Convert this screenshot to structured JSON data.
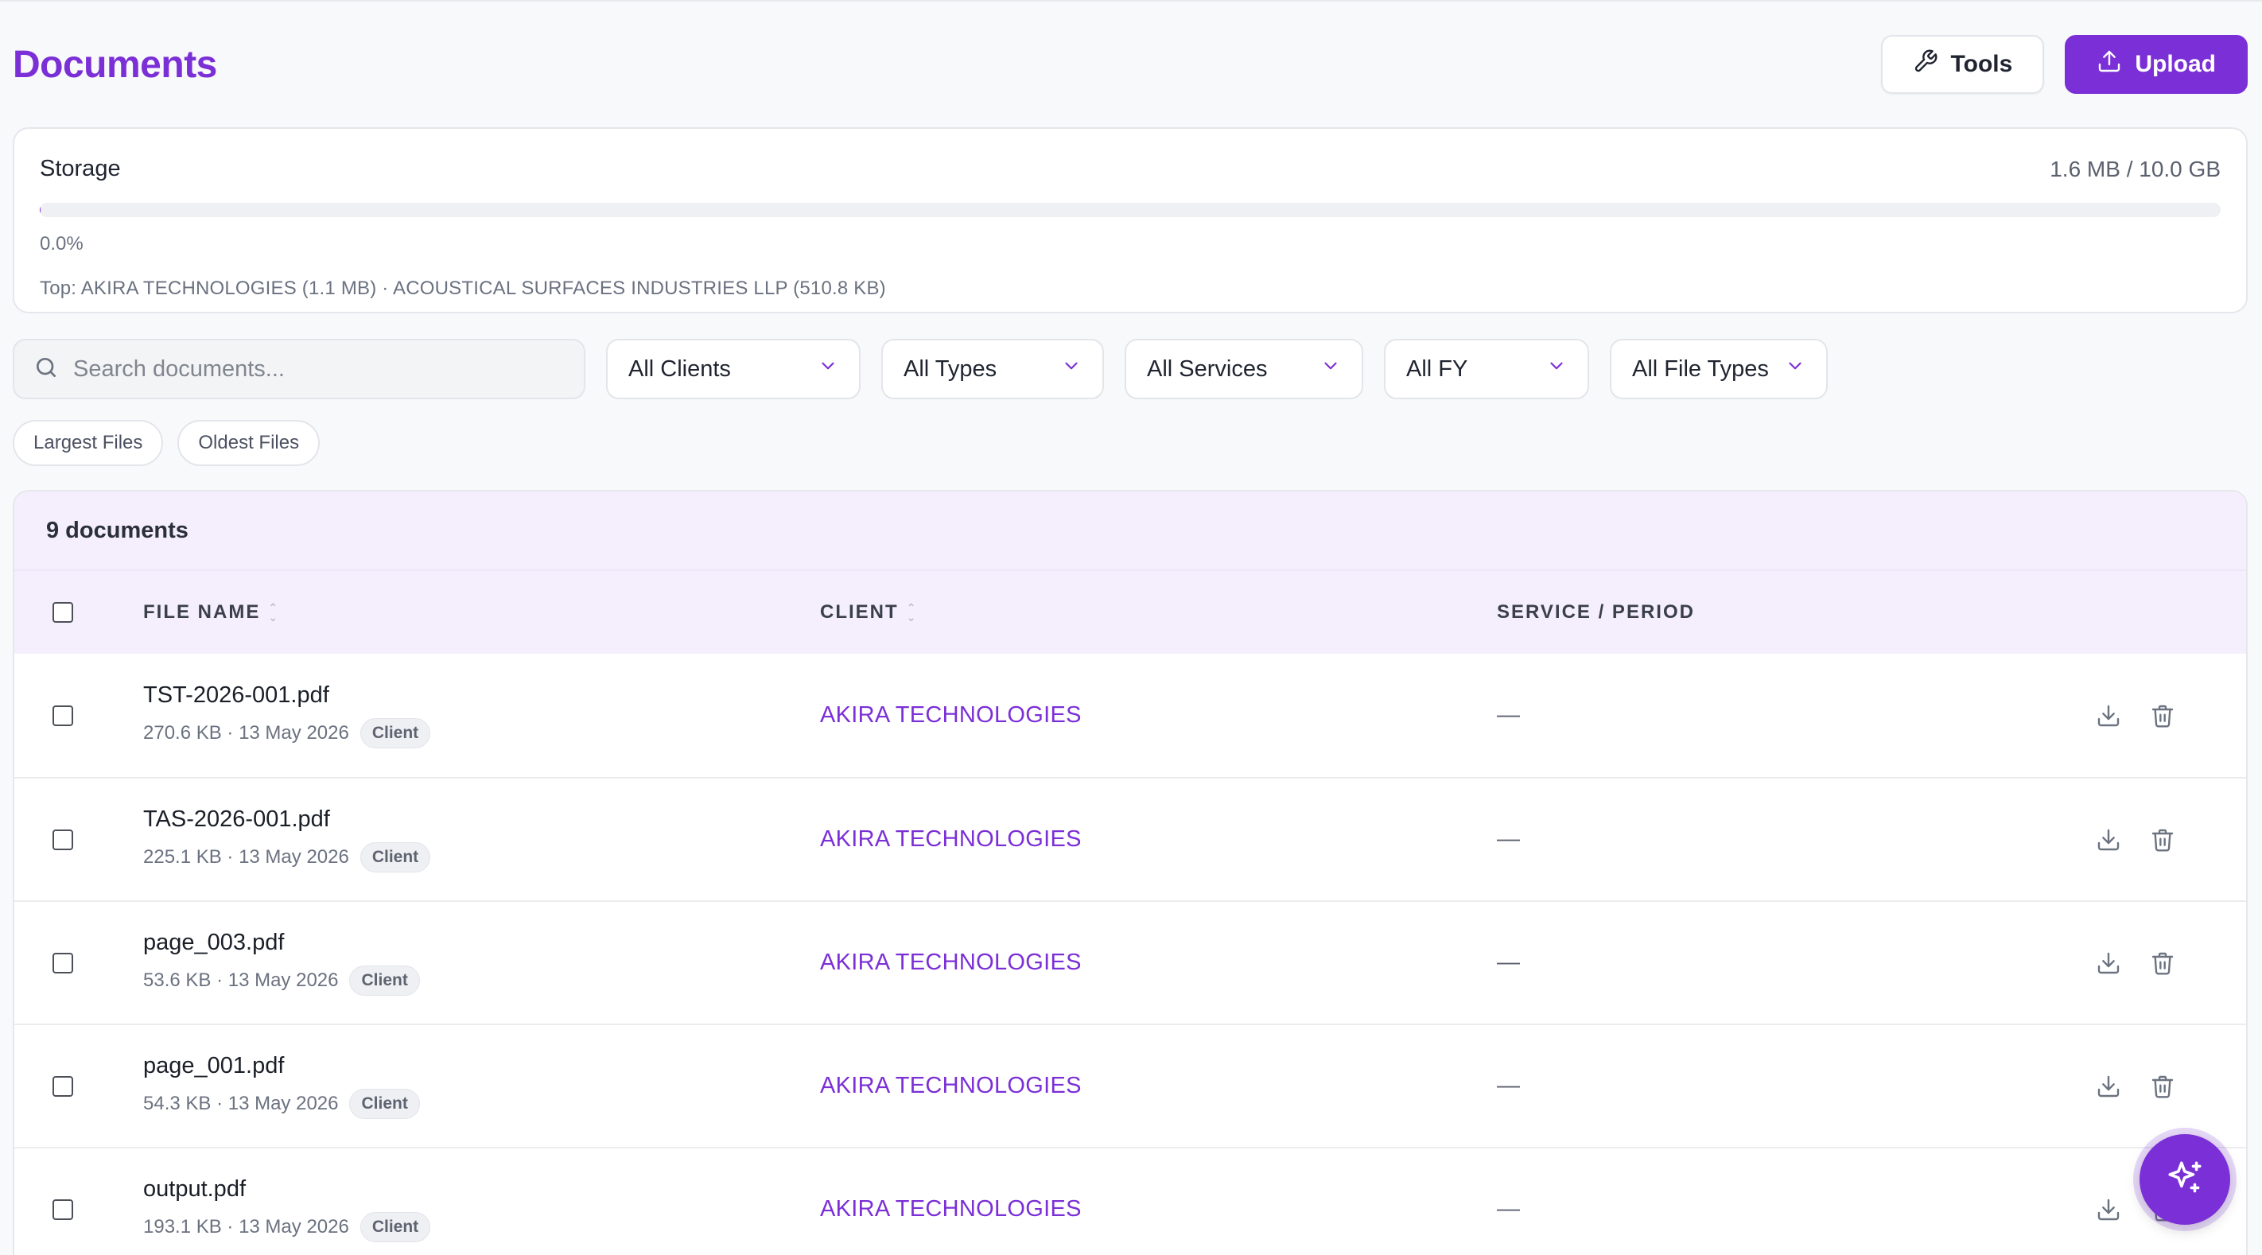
{
  "header": {
    "title": "Documents",
    "tools_label": "Tools",
    "upload_label": "Upload"
  },
  "storage": {
    "label": "Storage",
    "amount": "1.6 MB / 10.0 GB",
    "percent_text": "0.0%",
    "percent_value": 0.016,
    "top_text": "Top: AKIRA TECHNOLOGIES (1.1 MB) · ACOUSTICAL SURFACES INDUSTRIES LLP (510.8 KB)"
  },
  "filters": {
    "search_placeholder": "Search documents...",
    "clients": "All Clients",
    "types": "All Types",
    "services": "All Services",
    "fy": "All FY",
    "file_types": "All File Types"
  },
  "chips": [
    "Largest Files",
    "Oldest Files"
  ],
  "table": {
    "count_label": "9 documents",
    "columns": {
      "file_name": "FILE NAME",
      "client": "CLIENT",
      "service": "SERVICE / PERIOD"
    },
    "rows": [
      {
        "name": "TST-2026-001.pdf",
        "meta": "270.6 KB · 13 May 2026",
        "badge": "Client",
        "client": "AKIRA TECHNOLOGIES",
        "service": "—"
      },
      {
        "name": "TAS-2026-001.pdf",
        "meta": "225.1 KB · 13 May 2026",
        "badge": "Client",
        "client": "AKIRA TECHNOLOGIES",
        "service": "—"
      },
      {
        "name": "page_003.pdf",
        "meta": "53.6 KB · 13 May 2026",
        "badge": "Client",
        "client": "AKIRA TECHNOLOGIES",
        "service": "—"
      },
      {
        "name": "page_001.pdf",
        "meta": "54.3 KB · 13 May 2026",
        "badge": "Client",
        "client": "AKIRA TECHNOLOGIES",
        "service": "—"
      },
      {
        "name": "output.pdf",
        "meta": "193.1 KB · 13 May 2026",
        "badge": "Client",
        "client": "AKIRA TECHNOLOGIES",
        "service": "—"
      }
    ]
  },
  "icons": {
    "tools": "wrench-icon",
    "upload": "upload-icon",
    "search": "search-icon",
    "chevron": "chevron-down-icon",
    "download": "download-icon",
    "delete": "trash-icon",
    "assistant": "sparkles-icon"
  },
  "colors": {
    "accent": "#7b2fd6",
    "header_bg": "#f5effd"
  }
}
